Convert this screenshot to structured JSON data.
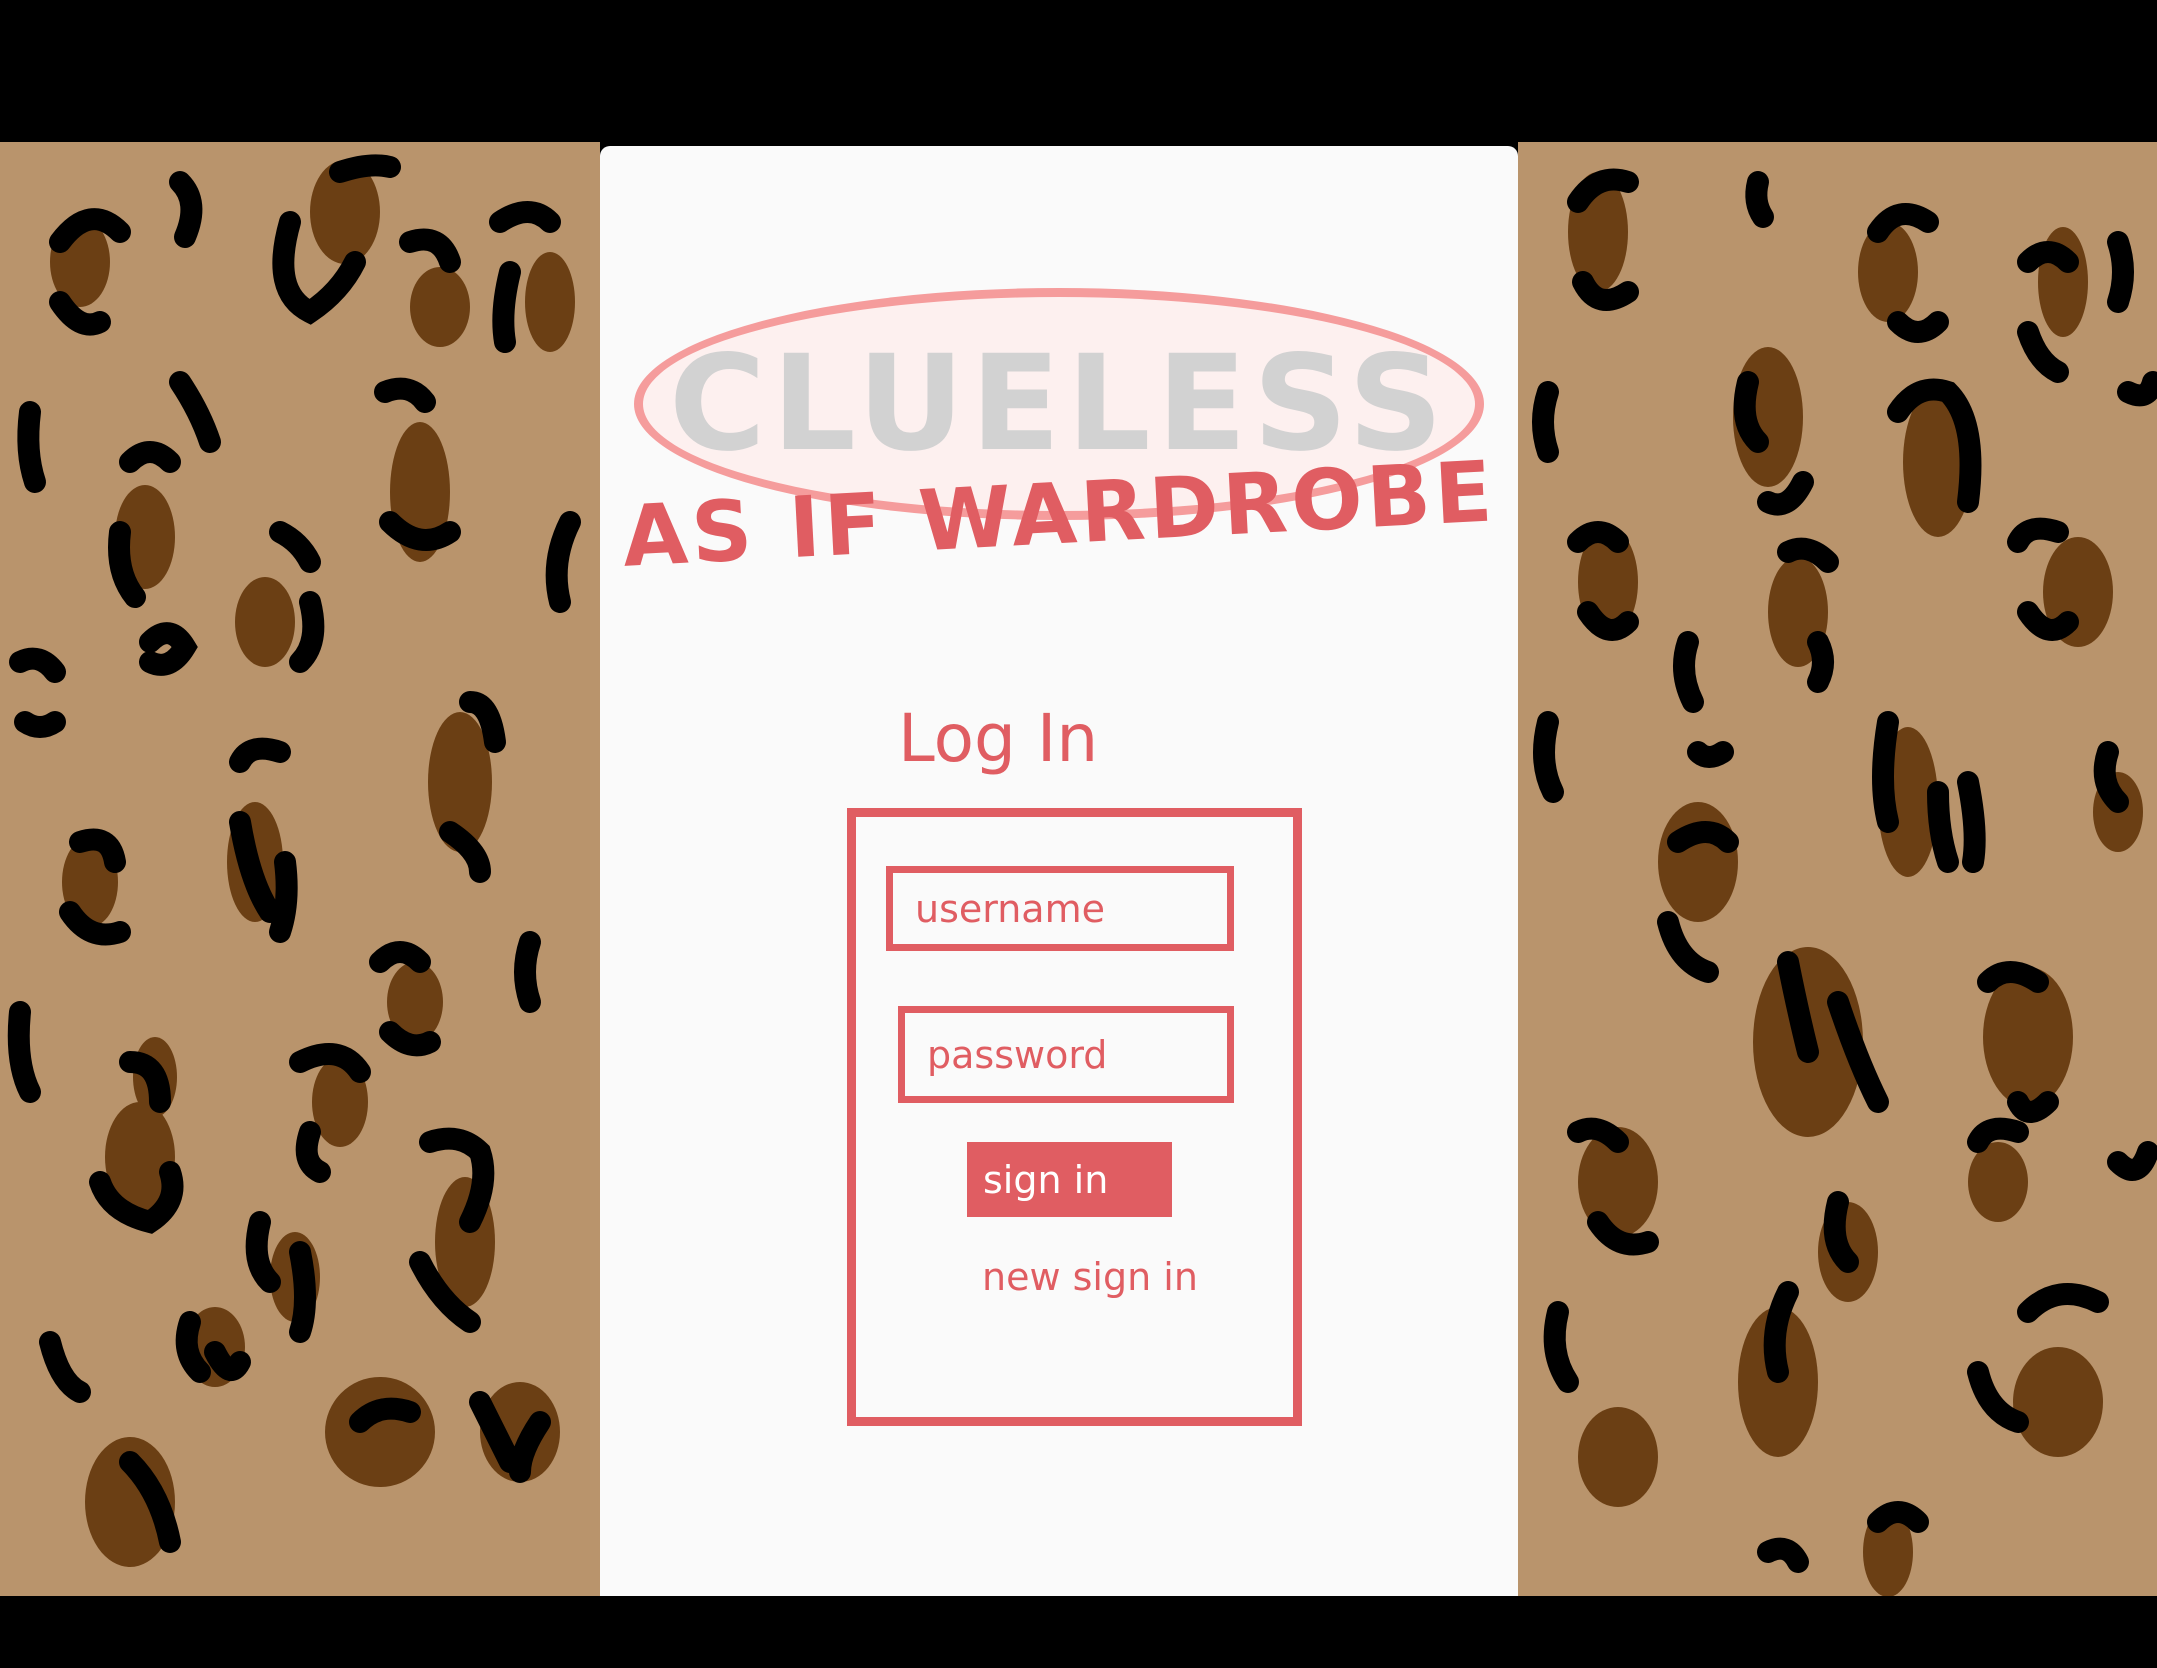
{
  "app": {
    "logo_text": "CLUELESS",
    "tagline": "AS IF WARDROBE"
  },
  "login": {
    "title": "Log In",
    "username_placeholder": "username",
    "password_placeholder": "password",
    "sign_in_label": "sign in",
    "new_sign_in_label": "new sign in"
  },
  "colors": {
    "accent": "#e05d62",
    "logo_outline": "#f59c9c",
    "logo_text": "#d2d2d2",
    "card_background": "#fafafa",
    "leopard_base": "#b9946c",
    "leopard_spot_inner": "#6b3f14",
    "leopard_spot_outer": "#000000"
  },
  "background": {
    "pattern": "leopard-print"
  }
}
